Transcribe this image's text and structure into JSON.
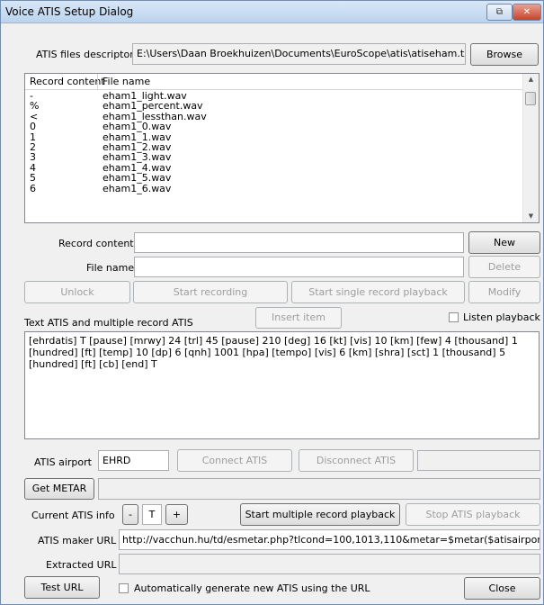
{
  "window": {
    "title": "Voice ATIS Setup Dialog"
  },
  "descriptor": {
    "label": "ATIS files descriptor",
    "path": "E:\\Users\\Daan Broekhuizen\\Documents\\EuroScope\\atis\\atiseham.txt",
    "browse_label": "Browse"
  },
  "records": {
    "col_content": "Record content",
    "col_file": "File name",
    "rows": [
      {
        "content": "-",
        "file": "eham1_light.wav"
      },
      {
        "content": "%",
        "file": "eham1_percent.wav"
      },
      {
        "content": "<",
        "file": "eham1_lessthan.wav"
      },
      {
        "content": "0",
        "file": "eham1_0.wav"
      },
      {
        "content": "1",
        "file": "eham1_1.wav"
      },
      {
        "content": "2",
        "file": "eham1_2.wav"
      },
      {
        "content": "3",
        "file": "eham1_3.wav"
      },
      {
        "content": "4",
        "file": "eham1_4.wav"
      },
      {
        "content": "5",
        "file": "eham1_5.wav"
      },
      {
        "content": "6",
        "file": "eham1_6.wav"
      }
    ]
  },
  "editor": {
    "record_content_label": "Record content",
    "record_content_value": "",
    "file_name_label": "File name",
    "file_name_value": "",
    "new_label": "New",
    "delete_label": "Delete",
    "unlock_label": "Unlock",
    "start_recording_label": "Start recording",
    "start_single_label": "Start single record playback",
    "modify_label": "Modify"
  },
  "text_atis": {
    "label": "Text ATIS and multiple record ATIS",
    "insert_label": "Insert item",
    "listen_label": "Listen playback",
    "listen_checked": false,
    "text": "[ehrdatis] T [pause] [mrwy] 24 [trl] 45 [pause] 210 [deg] 16 [kt] [vis] 10 [km] [few] 4 [thousand] 1 [hundred] [ft] [temp] 10 [dp] 6 [qnh] 1001 [hpa] [tempo] [vis] 6 [km] [shra] [sct] 1 [thousand] 5 [hundred] [ft] [cb] [end] T"
  },
  "airport": {
    "label": "ATIS airport",
    "value": "EHRD",
    "connect_label": "Connect ATIS",
    "disconnect_label": "Disconnect ATIS",
    "status": ""
  },
  "metar": {
    "get_label": "Get METAR",
    "value": ""
  },
  "info": {
    "label": "Current ATIS info",
    "minus": "-",
    "letter": "T",
    "plus": "+",
    "start_multi_label": "Start multiple record playback",
    "stop_label": "Stop ATIS playback"
  },
  "maker": {
    "label": "ATIS maker URL",
    "url": "http://vacchun.hu/td/esmetar.php?tlcond=100,1013,110&metar=$metar($atisairport)&ar"
  },
  "extracted": {
    "label": "Extracted URL",
    "value": ""
  },
  "footer": {
    "test_label": "Test URL",
    "auto_label": "Automatically generate new ATIS using the URL",
    "auto_checked": false,
    "close_label": "Close"
  }
}
